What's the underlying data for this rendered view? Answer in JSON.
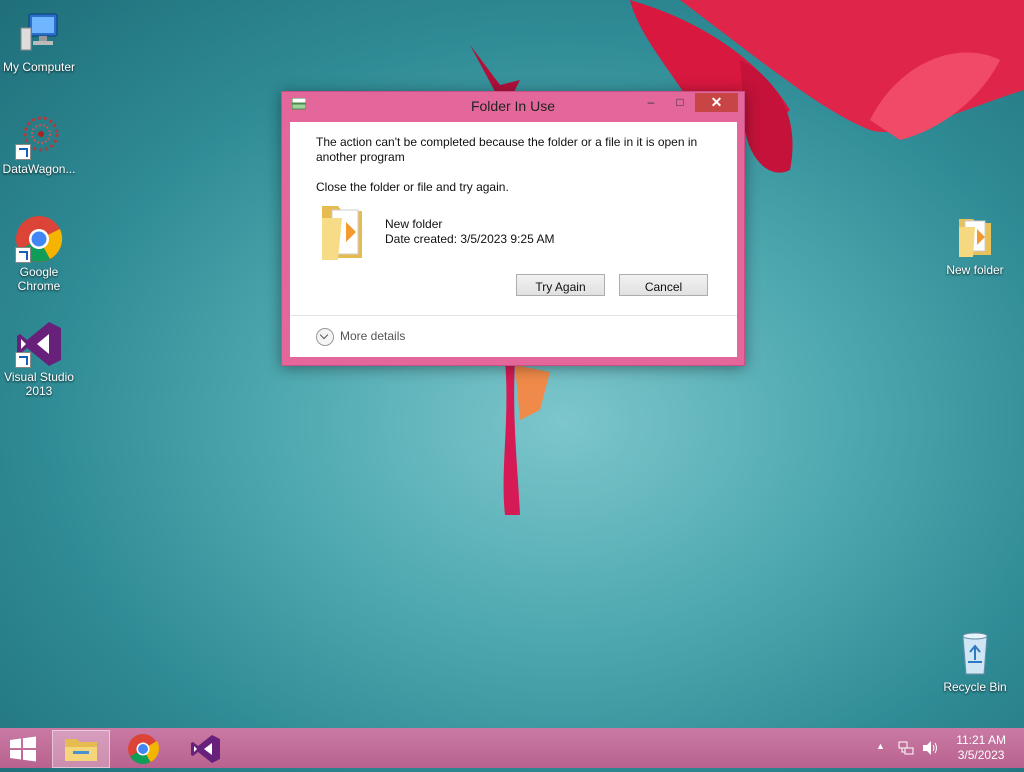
{
  "desktop": {
    "icons": [
      {
        "label": "My Computer"
      },
      {
        "label": "DataWagon..."
      },
      {
        "label": "Google Chrome"
      },
      {
        "label": "Visual Studio 2013"
      },
      {
        "label": "New folder"
      },
      {
        "label": "Recycle Bin"
      }
    ]
  },
  "dialog": {
    "title": "Folder In Use",
    "min_glyph": "–",
    "max_glyph": "□",
    "close_glyph": "✕",
    "message": "The action can't be completed because the folder or a file in it is open in another program",
    "instruction": "Close the folder or file and try again.",
    "item_name": "New folder",
    "item_date": "Date created: 3/5/2023 9:25 AM",
    "try_again_label": "Try Again",
    "cancel_label": "Cancel",
    "more_details_label": "More details"
  },
  "taskbar": {
    "items": [
      "file-explorer",
      "google-chrome",
      "visual-studio"
    ],
    "active_item": "file-explorer",
    "tray_arrow": "▲",
    "clock_time": "11:21 AM",
    "clock_date": "3/5/2023"
  },
  "colors": {
    "dialog_frame": "#e4679b",
    "taskbar": "#c97aa4",
    "close_button": "#c74545",
    "desktop_accent": "#4fa9b0"
  }
}
